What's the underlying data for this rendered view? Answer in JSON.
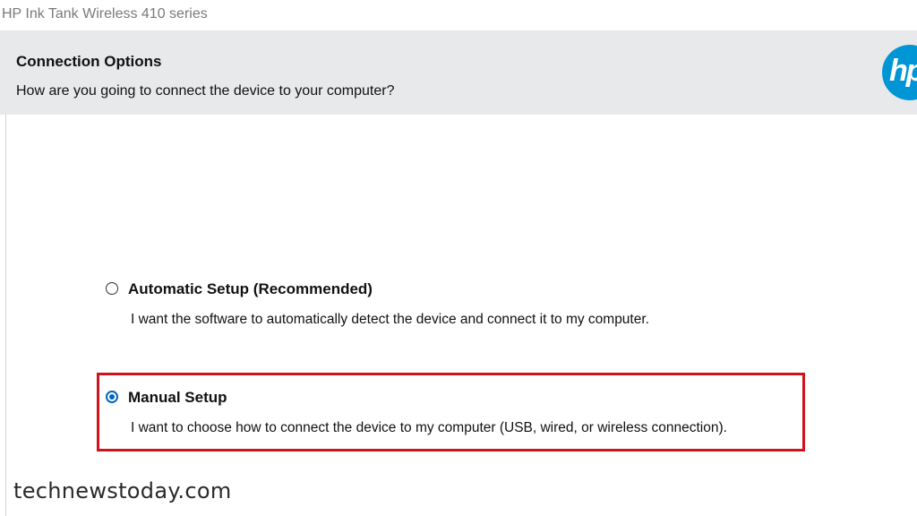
{
  "window": {
    "title": "HP Ink Tank Wireless 410 series"
  },
  "header": {
    "title": "Connection Options",
    "subtitle": "How are you going to connect the device to your computer?",
    "logo_text": "hp"
  },
  "options": [
    {
      "label": "Automatic Setup (Recommended)",
      "description": "I want the software to automatically detect the device and connect it to my computer.",
      "selected": false
    },
    {
      "label": "Manual Setup",
      "description": "I want to choose how to connect the device to my computer (USB, wired, or wireless connection).",
      "selected": true
    }
  ],
  "highlight": {
    "target": "Manual Setup",
    "color": "#d0121b"
  },
  "colors": {
    "header_bg": "#e8e9ea",
    "radio_accent": "#0067c0",
    "hp_blue": "#0096d6"
  },
  "watermark": "technewstoday.com"
}
